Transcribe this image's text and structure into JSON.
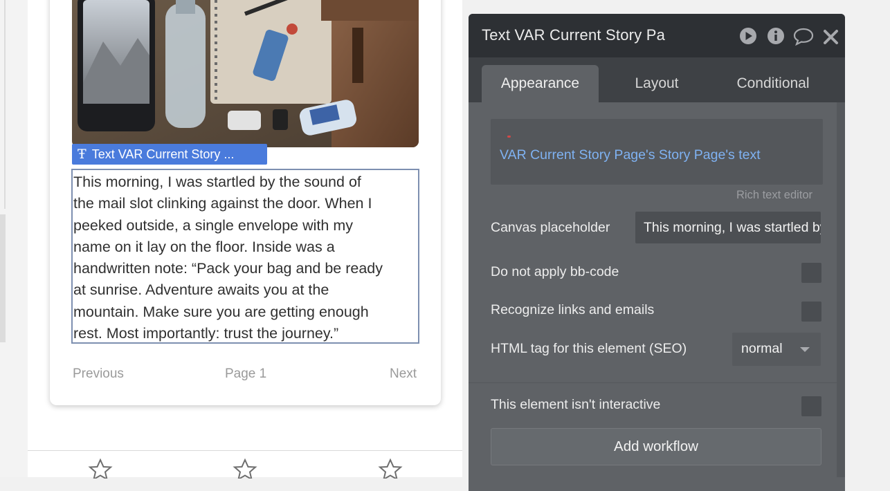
{
  "canvas": {
    "element_tag": {
      "icon": "text-type-icon",
      "label": "Text VAR Current Story ..."
    },
    "story_lines": [
      "This morning, I was startled by the sound of",
      "the mail slot clinking against the door. When I",
      "peeked outside, a single envelope with my",
      "name on it lay on the floor. Inside was a",
      "handwritten note: “Pack your bag and be ready",
      "at sunrise. Adventure awaits you at the",
      "mountain. Make sure you are getting enough",
      "rest. Most importantly: trust the journey.”"
    ],
    "pager": {
      "previous": "Previous",
      "page": "Page 1",
      "next": "Next"
    },
    "rating_icons": [
      "star-outline-icon",
      "star-outline-icon",
      "star-outline-icon"
    ]
  },
  "panel": {
    "title": "Text VAR Current Story Pa",
    "header_icons": [
      "play-icon",
      "info-icon",
      "comment-icon",
      "close-icon"
    ],
    "tabs": [
      {
        "label": "Appearance",
        "active": true
      },
      {
        "label": "Layout",
        "active": false
      },
      {
        "label": "Conditional",
        "active": false
      }
    ],
    "rich_text": {
      "value": "VAR Current Story Page's Story Page's text",
      "caption": "Rich text editor"
    },
    "canvas_placeholder": {
      "label": "Canvas placeholder",
      "value": "This morning, I was startled by the sound of"
    },
    "options": {
      "bb_code": {
        "label": "Do not apply bb-code",
        "checked": false
      },
      "links": {
        "label": "Recognize links and emails",
        "checked": false
      },
      "html_tag": {
        "label": "HTML tag for this element (SEO)",
        "value": "normal"
      },
      "not_interactive": {
        "label": "This element isn't interactive",
        "checked": false
      }
    },
    "add_workflow": "Add workflow"
  },
  "colors": {
    "panel_bg": "#5f6266",
    "panel_header": "#2d3034",
    "tag_blue": "#4a7bdc",
    "dynamic_text": "#7fb2f2"
  }
}
